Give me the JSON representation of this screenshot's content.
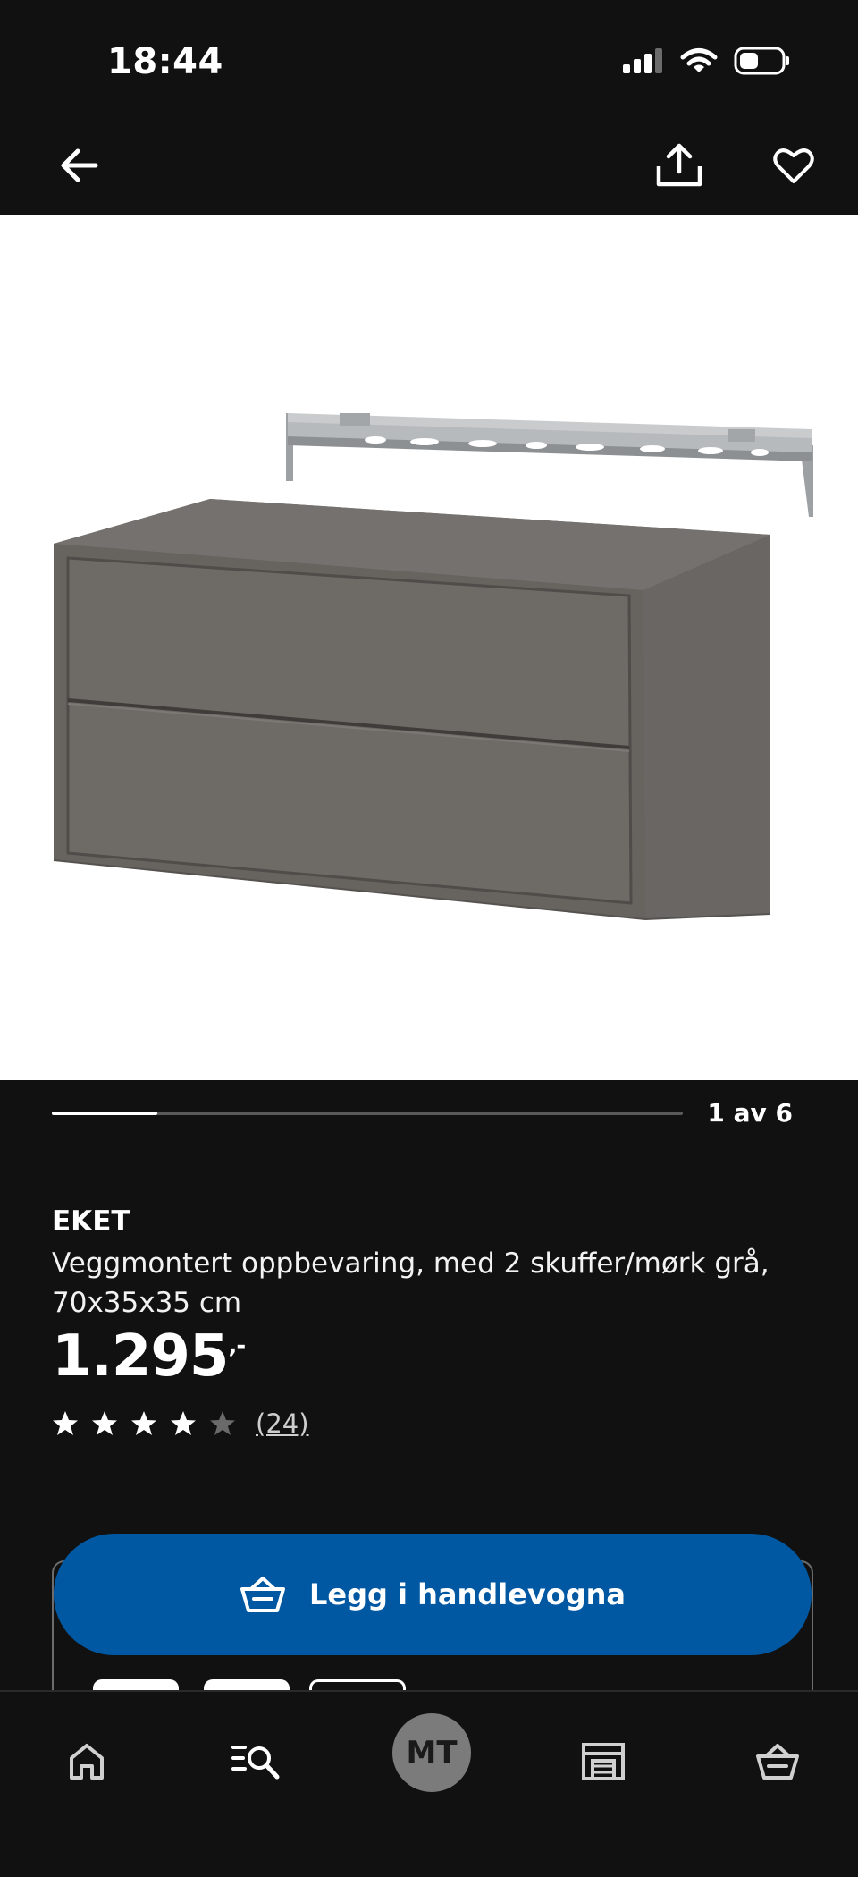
{
  "status_bar": {
    "time": "18:44"
  },
  "product": {
    "name": "EKET",
    "description": "Veggmontert oppbevaring, med 2 skuffer/mørk grå, 70x35x35 cm",
    "price": "1.295",
    "price_suffix": ",-",
    "rating": 4,
    "rating_max": 5,
    "rating_count": "(24)"
  },
  "carousel": {
    "counter": "1 av 6",
    "current": 1,
    "total": 6
  },
  "actions": {
    "add_to_cart_label": "Legg i handlevogna"
  },
  "bottom_nav": {
    "avatar_initials": "MT"
  },
  "colors": {
    "background": "#111111",
    "primary_button": "#0058a3",
    "product_gray": "#6b6865",
    "rail_metal": "#a7aaad"
  }
}
